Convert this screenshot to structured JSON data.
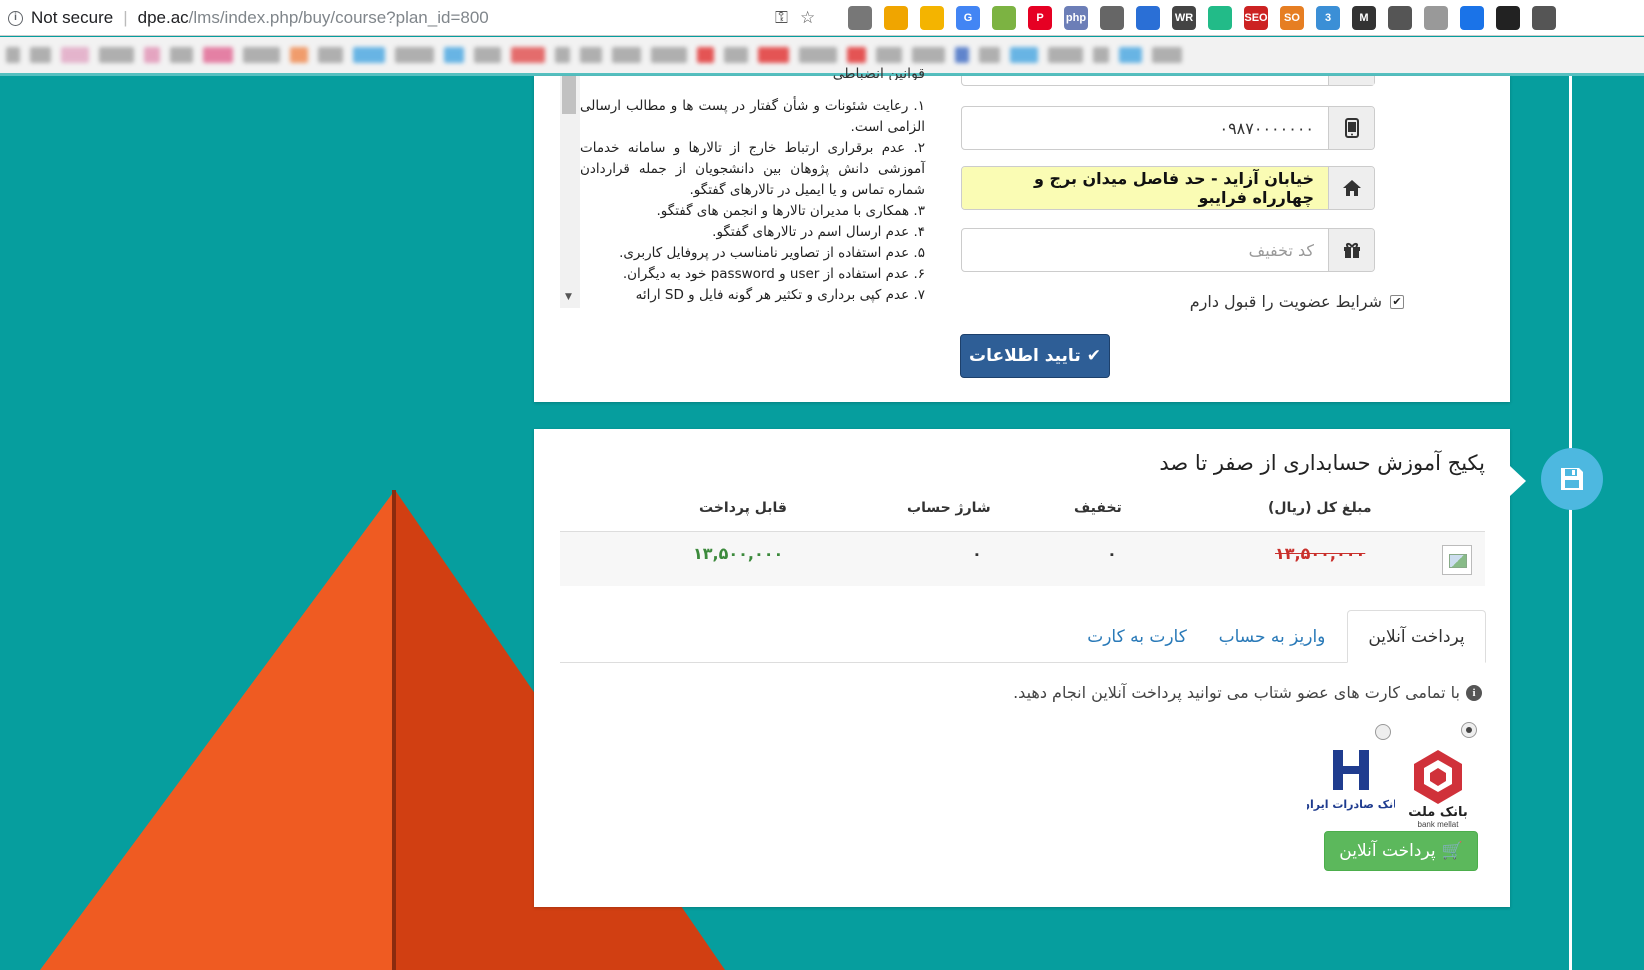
{
  "browser": {
    "security_label": "Not secure",
    "url_host": "dpe.ac",
    "url_path": "/lms/index.php/buy/course?plan_id=800",
    "extensions": [
      {
        "name": "camera-icon",
        "label": "",
        "color": "#777"
      },
      {
        "name": "eyedropper-icon",
        "label": "",
        "color": "#f0a500"
      },
      {
        "name": "shield-icon",
        "label": "",
        "color": "#f4b400"
      },
      {
        "name": "translate-icon",
        "label": "G",
        "color": "#4285f4"
      },
      {
        "name": "android-icon",
        "label": "",
        "color": "#7cb342"
      },
      {
        "name": "pinterest-icon",
        "label": "P",
        "color": "#e60023"
      },
      {
        "name": "php-icon",
        "label": "php",
        "color": "#6c7eb7"
      },
      {
        "name": "tool-icon",
        "label": "",
        "color": "#666"
      },
      {
        "name": "person-icon",
        "label": "",
        "color": "#2a6fd6"
      },
      {
        "name": "wr-icon",
        "label": "WR",
        "color": "#444"
      },
      {
        "name": "chart-icon",
        "label": "",
        "color": "#2b8"
      },
      {
        "name": "seo-icon",
        "label": "SEO",
        "color": "#c22"
      },
      {
        "name": "so-icon",
        "label": "SO",
        "color": "#e67e22"
      },
      {
        "name": "badge-icon",
        "label": "3",
        "color": "#3b8fd6"
      },
      {
        "name": "m-icon",
        "label": "M",
        "color": "#333"
      },
      {
        "name": "bird-icon",
        "label": "",
        "color": "#555"
      },
      {
        "name": "note-icon",
        "label": "",
        "color": "#999"
      },
      {
        "name": "check-circle-icon",
        "label": "",
        "color": "#1a73e8"
      },
      {
        "name": "download-icon",
        "label": "",
        "color": "#222"
      },
      {
        "name": "exit-icon",
        "label": "",
        "color": "#555"
      }
    ],
    "bookmark_colors": [
      "#999",
      "#999",
      "#e0a0c0",
      "#999",
      "#e08ab0",
      "#999",
      "#e05a8a",
      "#999",
      "#f08040",
      "#999",
      "#3aa0e0",
      "#999",
      "#3aa0e0",
      "#999",
      "#e04040",
      "#999",
      "#999",
      "#999",
      "#999",
      "#e02020",
      "#999",
      "#e02020",
      "#999",
      "#e02020",
      "#999",
      "#999",
      "#3060c0",
      "#999",
      "#3aa0e0",
      "#999",
      "#999",
      "#3aa0e0",
      "#999"
    ]
  },
  "terms": {
    "title": "قوانین انضباطی",
    "lines": [
      "۱. رعایت شئونات و شأن گفتار در پست ها و مطالب ارسالی الزامی است.",
      "۲. عدم برقراری ارتباط خارج از تالارها و سامانه خدمات آموزشی دانش پژوهان بین دانشجویان از جمله قراردادن شماره تماس و یا ایمیل در تالارهای گفتگو.",
      "۳. همکاری با مدیران تالارها و انجمن های گفتگو.",
      "۴. عدم ارسال اسم در تالارهای گفتگو.",
      "۵. عدم استفاده از تصاویر نامناسب در پروفایل کاربری.",
      "۶. عدم استفاده از user و password خود به دیگران.",
      "۷. عدم کپی برداری و تکثیر هر گونه فایل و SD ارائه"
    ]
  },
  "form": {
    "phone_value": "۰۹۸۷۰۰۰۰۰۰۰",
    "address_value": "خیابان آزاید - حد فاصل میدان برج و چهارراه فرایبو",
    "discount_placeholder": "کد تخفیف",
    "accept_terms_label": "شرایط عضویت را قبول دارم",
    "accept_terms_checked": true,
    "confirm_label": "تایید اطلاعات"
  },
  "package": {
    "title": "پکیج آموزش حسابداری از صفر تا صد",
    "headers": {
      "total": "مبلغ کل (ریال)",
      "discount": "تخفیف",
      "credit": "شارژ حساب",
      "payable": "قابل پرداخت"
    },
    "row": {
      "total": "۱۳,۵۰۰,۰۰۰",
      "discount": "۰",
      "credit": "۰",
      "payable": "۱۳,۵۰۰,۰۰۰"
    },
    "colors": {
      "strike_red": "#c9302c",
      "payable_green": "#3c8a3c"
    }
  },
  "payment": {
    "tabs": [
      "پرداخت آنلاین",
      "واریز به حساب",
      "کارت به کارت"
    ],
    "active_tab": 0,
    "info_text": "با تمامی کارت های عضو شتاب می توانید پرداخت آنلاین انجام دهید.",
    "banks": [
      {
        "name": "بانک ملت",
        "subtitle": "bank mellat",
        "selected": true
      },
      {
        "name": "بانک صادرات ایران",
        "selected": false
      }
    ],
    "pay_button_label": "پرداخت آنلاین"
  }
}
